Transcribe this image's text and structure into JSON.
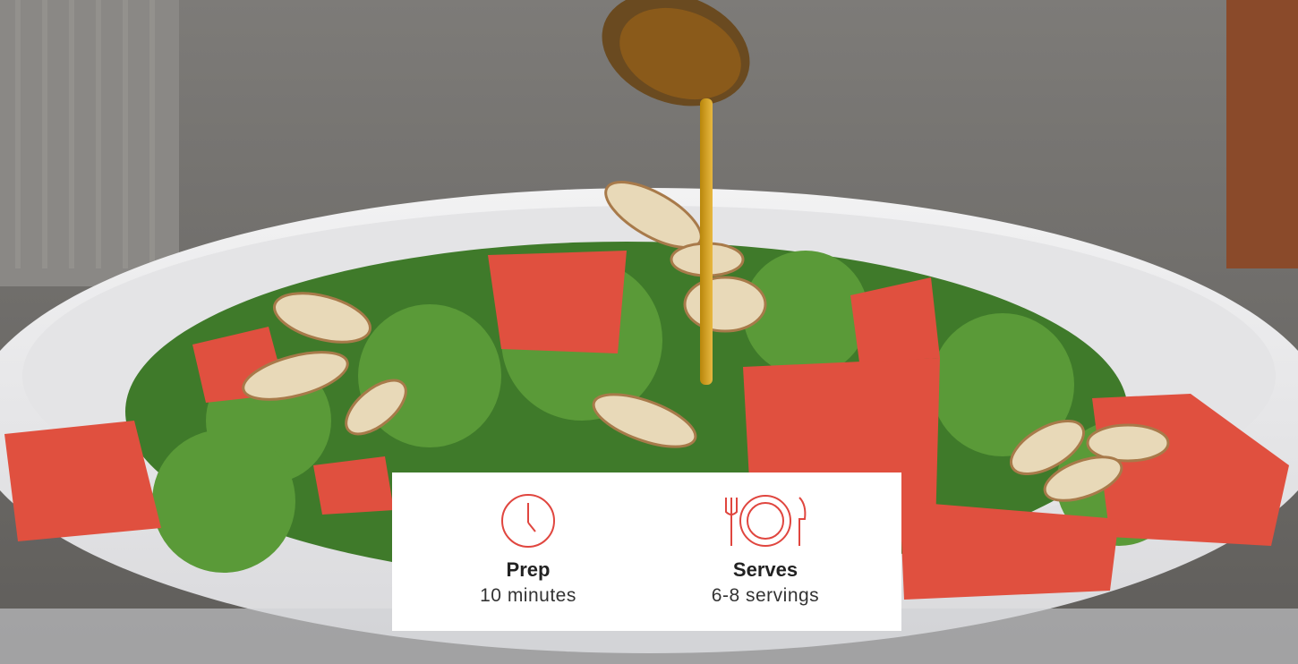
{
  "image": {
    "subject": "watermelon salad with herbs and almonds in white bowl, dressing drizzled from spoon"
  },
  "recipe_info": {
    "accent_color": "#e0463f",
    "items": [
      {
        "icon": "clock-icon",
        "label": "Prep",
        "value": "10 minutes"
      },
      {
        "icon": "plate-utensils-icon",
        "label": "Serves",
        "value": "6-8 servings"
      }
    ]
  }
}
